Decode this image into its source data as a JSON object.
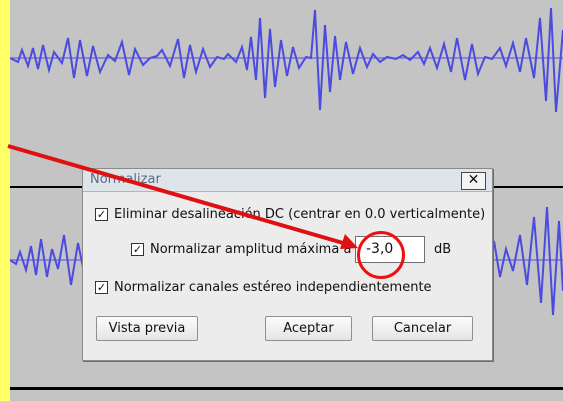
{
  "dialog": {
    "title": "Normalizar",
    "close_label": "✕",
    "options": [
      {
        "label": "Eliminar desalineación DC (centrar en 0.0 verticalmente)",
        "checked": true
      },
      {
        "label": "Normalizar amplitud máxima a",
        "checked": true
      },
      {
        "label": "Normalizar canales estéreo independientemente",
        "checked": true
      }
    ],
    "amplitude_value": "-3,0",
    "amplitude_unit": "dB",
    "buttons": {
      "preview": "Vista previa",
      "ok": "Aceptar",
      "cancel": "Cancelar"
    }
  },
  "annotation": {
    "arrow_color": "#e11010",
    "circle_color": "#e11010"
  },
  "colors": {
    "waveform": "#4b4be0",
    "background_frame": "#ffff66",
    "track_bg": "#c4c4c4"
  }
}
